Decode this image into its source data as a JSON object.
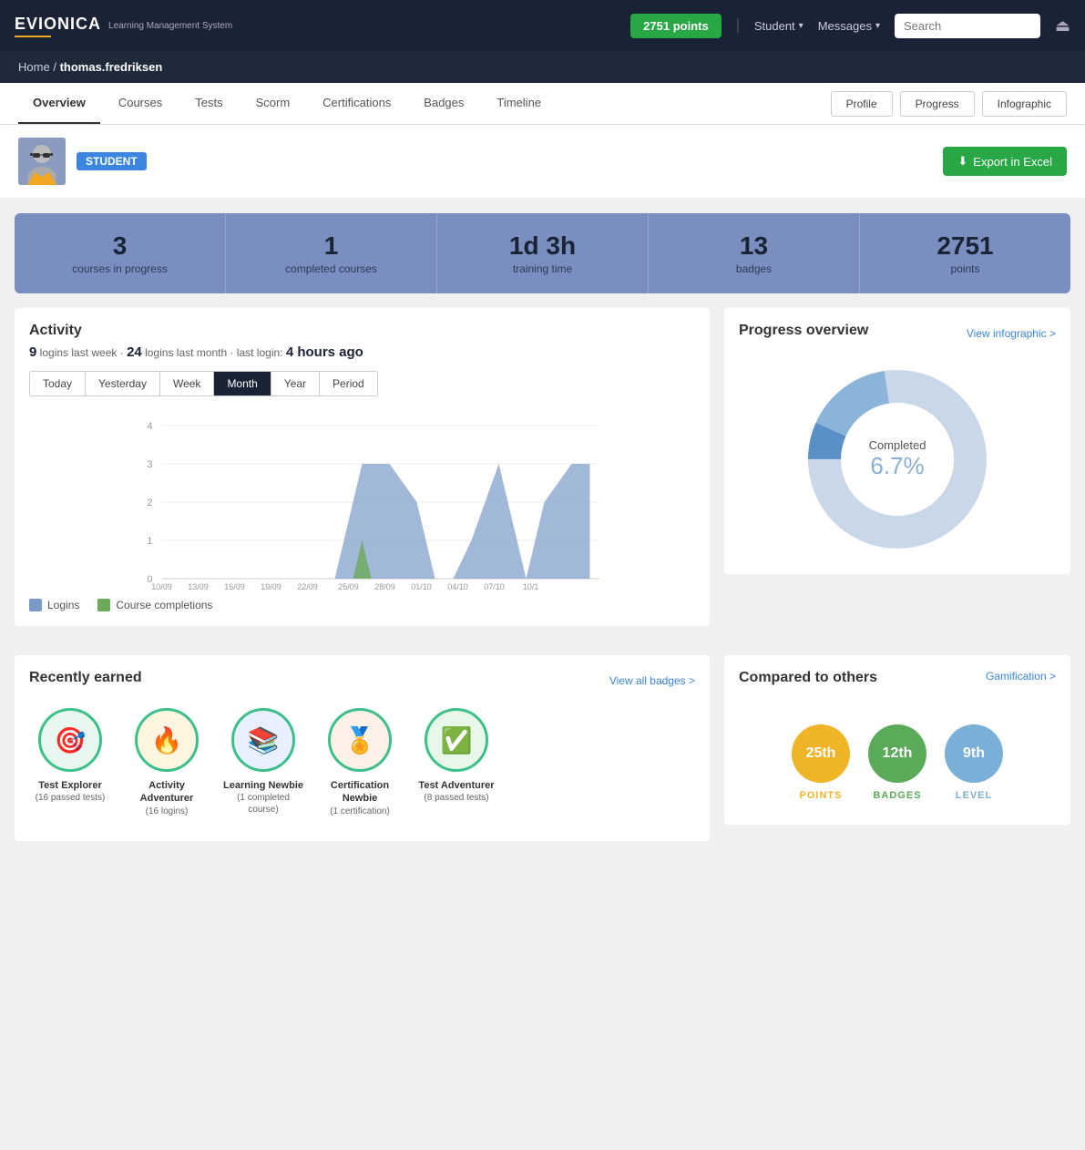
{
  "header": {
    "logo": "EVIONICA",
    "logo_subtitle": "Learning\nManagement\nSystem",
    "points": "2751 points",
    "student_label": "Student",
    "messages_label": "Messages",
    "search_placeholder": "Search",
    "logout_icon": "→"
  },
  "breadcrumb": {
    "home": "Home",
    "separator": "/",
    "current": "thomas.fredriksen"
  },
  "tabs": {
    "items": [
      {
        "label": "Overview",
        "active": true
      },
      {
        "label": "Courses"
      },
      {
        "label": "Tests"
      },
      {
        "label": "Scorm"
      },
      {
        "label": "Certifications"
      },
      {
        "label": "Badges"
      },
      {
        "label": "Timeline"
      }
    ],
    "right_buttons": [
      "Profile",
      "Progress",
      "Infographic"
    ]
  },
  "user": {
    "role_badge": "STUDENT",
    "export_btn": "Export in Excel"
  },
  "stats": [
    {
      "value": "3",
      "label": "courses in progress"
    },
    {
      "value": "1",
      "label": "completed courses"
    },
    {
      "value": "1d 3h",
      "label": "training time"
    },
    {
      "value": "13",
      "label": "badges"
    },
    {
      "value": "2751",
      "label": "points"
    }
  ],
  "activity": {
    "title": "Activity",
    "logins_week": "9",
    "logins_month": "24",
    "last_login": "4 hours ago",
    "subtitle_text_1": " logins last week · ",
    "subtitle_text_2": " logins last month · last login: ",
    "time_filters": [
      "Today",
      "Yesterday",
      "Week",
      "Month",
      "Year",
      "Period"
    ],
    "active_filter": "Month",
    "chart_x_labels": [
      "10/09",
      "13/09",
      "16/09",
      "19/09",
      "22/09",
      "25/09",
      "28/09",
      "01/10",
      "04/10",
      "07/10",
      "10/1"
    ],
    "chart_y_labels": [
      "0",
      "1",
      "2",
      "3",
      "4"
    ],
    "legend_logins": "Logins",
    "legend_completions": "Course completions"
  },
  "progress_overview": {
    "title": "Progress overview",
    "view_link": "View infographic >",
    "completed_label": "Completed",
    "completed_percent": "6.7%"
  },
  "recently_earned": {
    "title": "Recently earned",
    "view_all_link": "View all badges >",
    "badges": [
      {
        "name": "Test Explorer",
        "desc": "(16 passed\ntests)",
        "icon": "🎯",
        "color": "#4aba8a"
      },
      {
        "name": "Activity Adventurer",
        "desc": "(16 logins)",
        "icon": "🔥",
        "color": "#4aba8a"
      },
      {
        "name": "Learning Newbie",
        "desc": "(1 completed\ncourse)",
        "icon": "📚",
        "color": "#4aba8a"
      },
      {
        "name": "Certification Newbie",
        "desc": "(1\ncertification)",
        "icon": "🏅",
        "color": "#4aba8a"
      },
      {
        "name": "Test Adventurer",
        "desc": "(8 passed\ntests)",
        "icon": "✅",
        "color": "#4aba8a"
      }
    ]
  },
  "compared_to_others": {
    "title": "Compared to others",
    "gamification_link": "Gamification >",
    "ranks": [
      {
        "rank": "25th",
        "label": "POINTS",
        "color_class": "rank-yellow"
      },
      {
        "rank": "12th",
        "label": "BADGES",
        "color_class": "rank-green"
      },
      {
        "rank": "9th",
        "label": "LEVEL",
        "color_class": "rank-blue"
      }
    ]
  }
}
